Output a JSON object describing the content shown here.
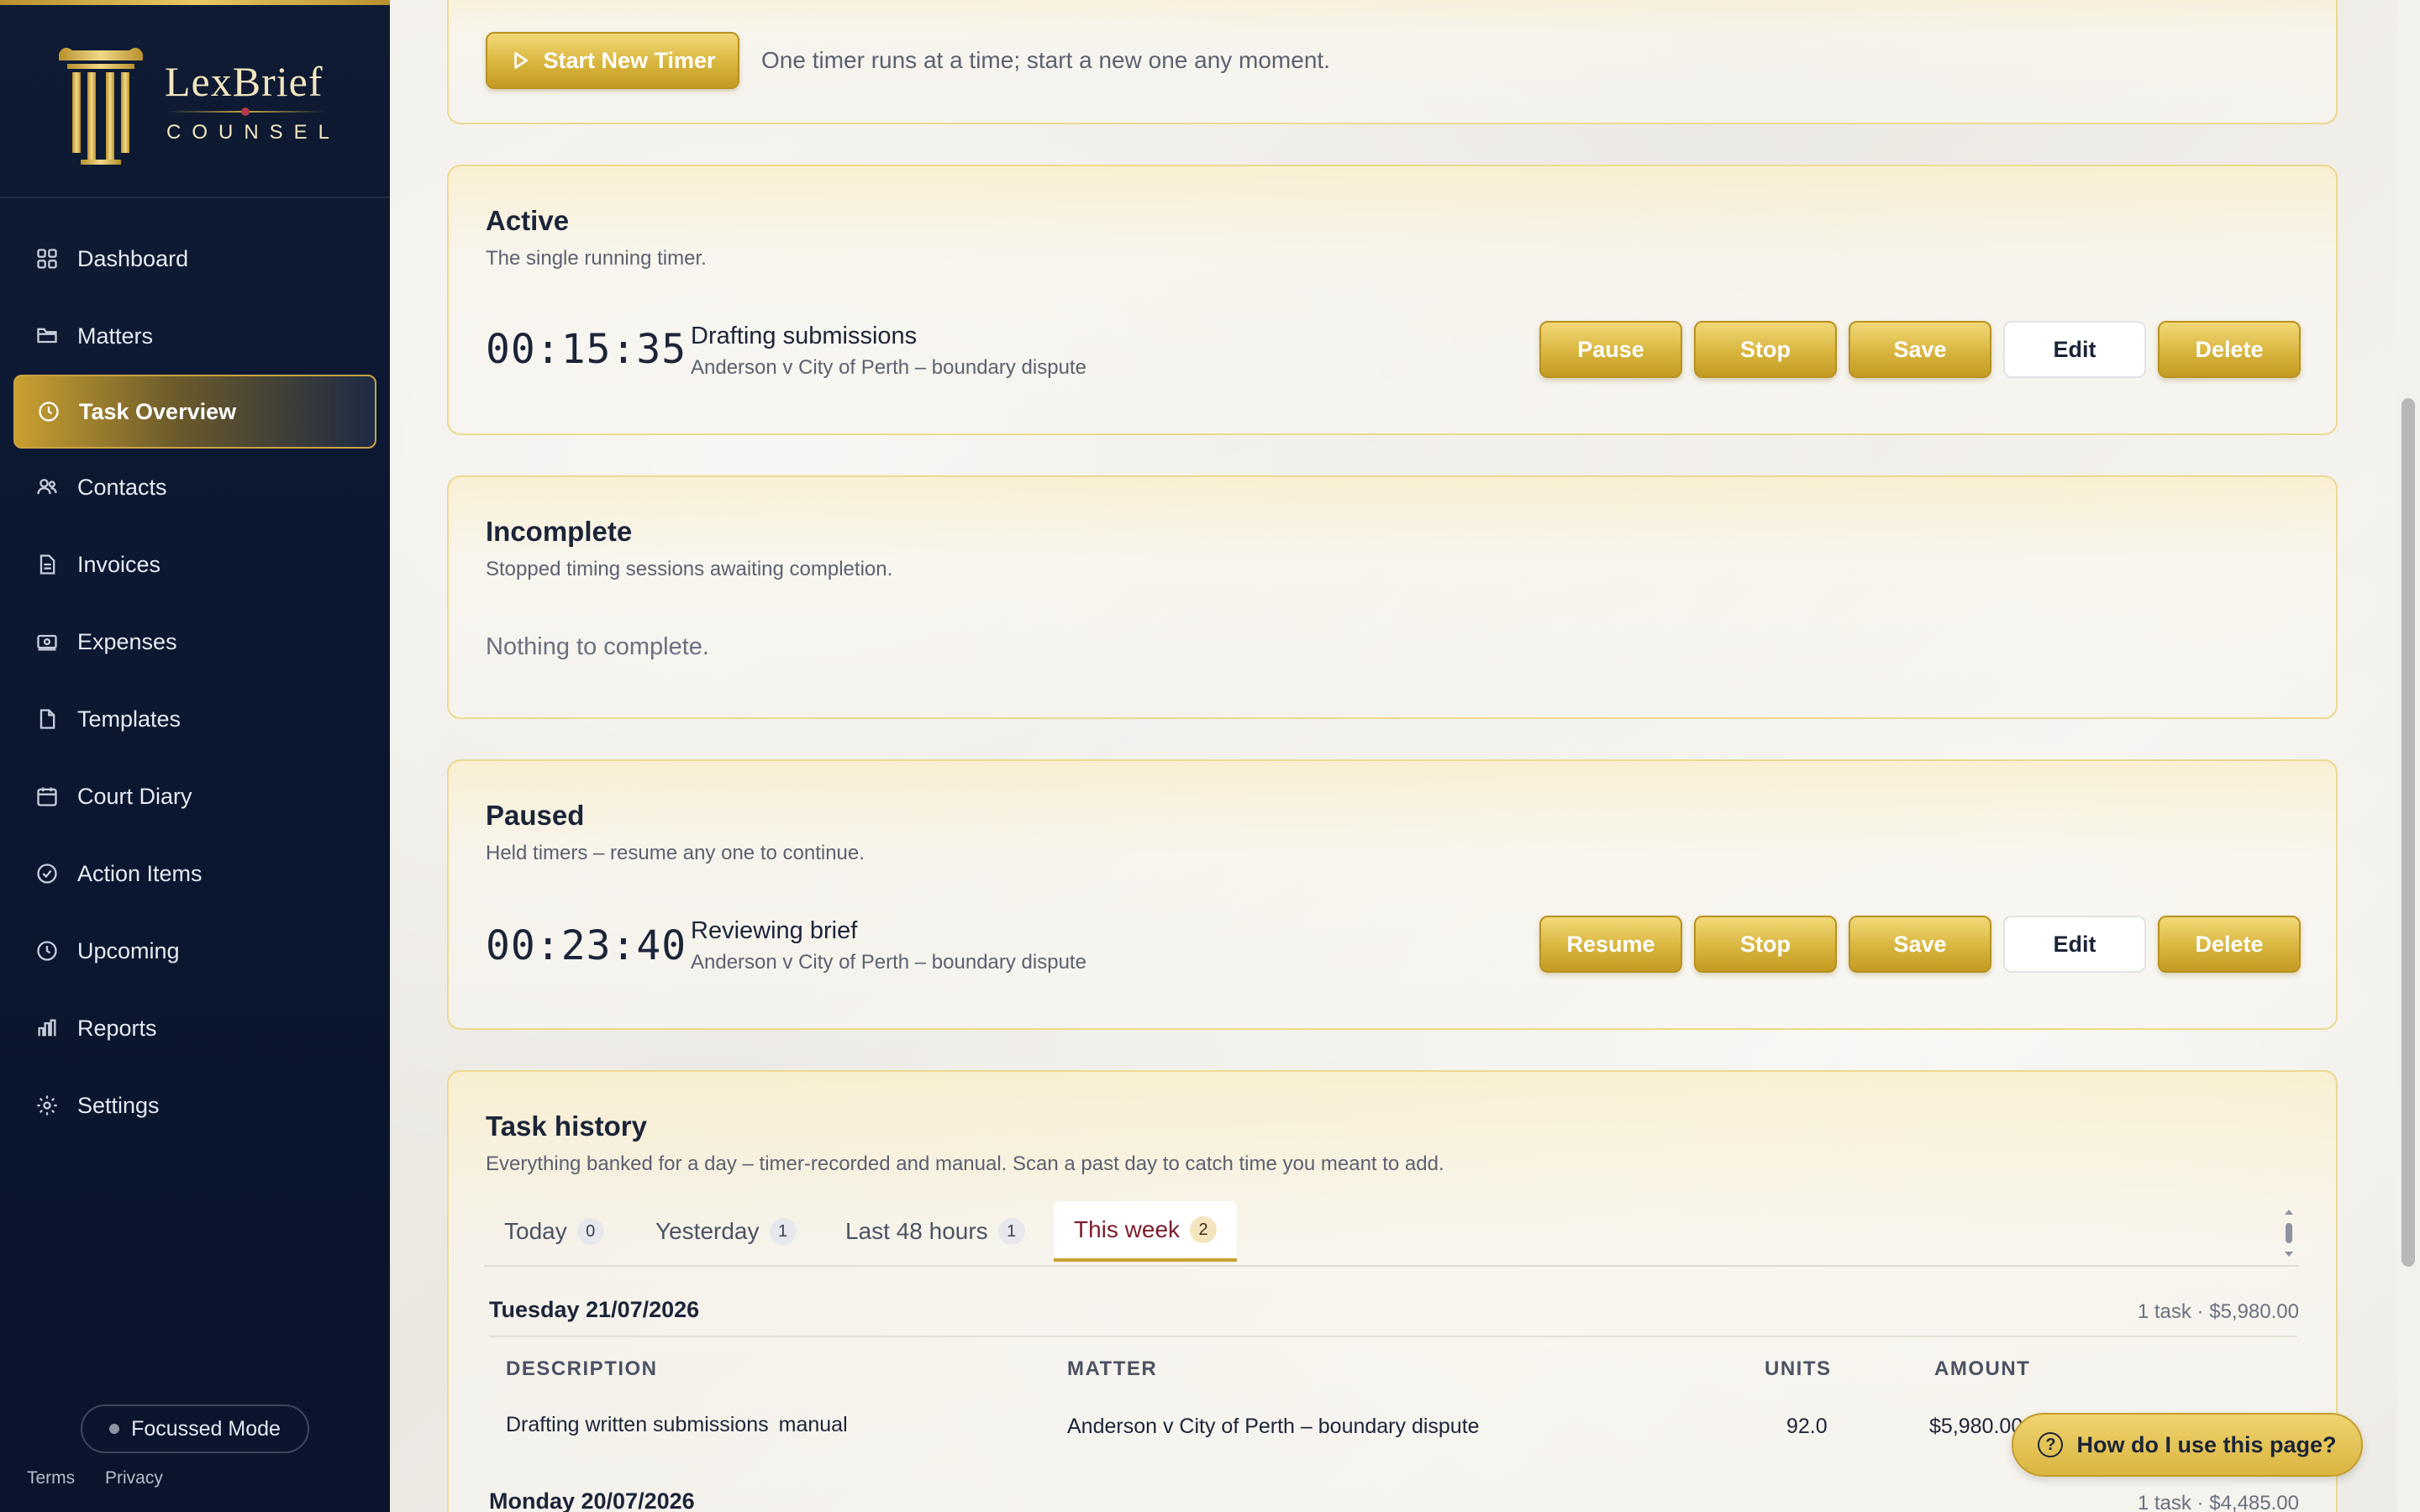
{
  "brand": {
    "name": "LexBrief",
    "sub": "COUNSEL"
  },
  "sidebar": {
    "items": [
      {
        "label": "Dashboard",
        "icon": "grid-icon"
      },
      {
        "label": "Matters",
        "icon": "folder-icon"
      },
      {
        "label": "Task Overview",
        "icon": "clock-icon",
        "active": true
      },
      {
        "label": "Contacts",
        "icon": "users-icon"
      },
      {
        "label": "Invoices",
        "icon": "invoice-icon"
      },
      {
        "label": "Expenses",
        "icon": "money-icon"
      },
      {
        "label": "Templates",
        "icon": "file-icon"
      },
      {
        "label": "Court Diary",
        "icon": "calendar-icon"
      },
      {
        "label": "Action Items",
        "icon": "check-circle-icon"
      },
      {
        "label": "Upcoming",
        "icon": "clock-icon"
      },
      {
        "label": "Reports",
        "icon": "bar-chart-icon"
      },
      {
        "label": "Settings",
        "icon": "gear-icon"
      }
    ],
    "focus_mode": "Focussed Mode",
    "terms": "Terms",
    "privacy": "Privacy"
  },
  "start": {
    "button": "Start New Timer",
    "hint": "One timer runs at a time; start a new one any moment."
  },
  "active": {
    "title": "Active",
    "desc": "The single running timer.",
    "timer": "00:15:35",
    "task": "Drafting submissions",
    "matter": "Anderson v City of Perth – boundary dispute",
    "buttons": {
      "pause": "Pause",
      "stop": "Stop",
      "save": "Save",
      "edit": "Edit",
      "delete": "Delete"
    }
  },
  "incomplete": {
    "title": "Incomplete",
    "desc": "Stopped timing sessions awaiting completion.",
    "empty": "Nothing to complete."
  },
  "paused": {
    "title": "Paused",
    "desc": "Held timers – resume any one to continue.",
    "timer": "00:23:40",
    "task": "Reviewing brief",
    "matter": "Anderson v City of Perth – boundary dispute",
    "buttons": {
      "resume": "Resume",
      "stop": "Stop",
      "save": "Save",
      "edit": "Edit",
      "delete": "Delete"
    }
  },
  "history": {
    "title": "Task history",
    "desc": "Everything banked for a day – timer-recorded and manual. Scan a past day to catch time you meant to add.",
    "tabs": [
      {
        "label": "Today",
        "count": "0"
      },
      {
        "label": "Yesterday",
        "count": "1"
      },
      {
        "label": "Last 48 hours",
        "count": "1"
      },
      {
        "label": "This week",
        "count": "2",
        "active": true
      }
    ],
    "days": [
      {
        "date": "Tuesday 21/07/2026",
        "meta": "1 task · $5,980.00",
        "columns": {
          "description": "DESCRIPTION",
          "matter": "MATTER",
          "units": "UNITS",
          "amount": "AMOUNT"
        },
        "rows": [
          {
            "description": "Drafting written submissions",
            "tag": "manual",
            "matter": "Anderson v City of Perth – boundary dispute",
            "units": "92.0",
            "amount": "$5,980.00"
          }
        ]
      },
      {
        "date": "Monday 20/07/2026",
        "meta": "1 task · $4,485.00"
      }
    ]
  },
  "help": {
    "label": "How do I use this page?"
  },
  "colors": {
    "navy": "#0f1b33",
    "gold": "#d8b53e",
    "accent_red": "#7b1c2c"
  }
}
